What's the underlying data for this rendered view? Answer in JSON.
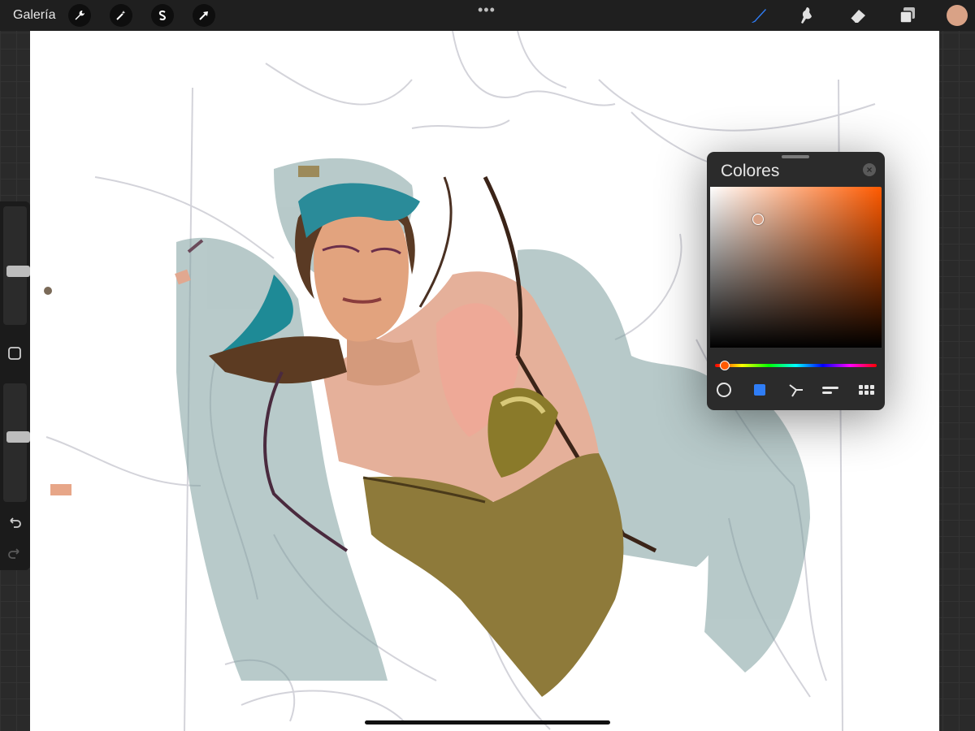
{
  "topbar": {
    "gallery_label": "Galería",
    "left_tools": [
      "wrench-icon",
      "magic-wand-icon",
      "selection-icon",
      "transform-icon"
    ],
    "more_label": "•••",
    "right_tools": [
      "brush-icon",
      "smudge-icon",
      "eraser-icon",
      "layers-icon"
    ],
    "active_tool": "brush-icon",
    "accent_color": "#2f7df6",
    "current_color": "#d9a286"
  },
  "sidebar": {
    "brush_size_level": 0.45,
    "opacity_level": 0.55,
    "undo_icon": "undo-icon",
    "redo_icon": "redo-icon",
    "modify_icon": "square-icon"
  },
  "color_panel": {
    "title": "Colores",
    "hue_color": "#ff5a00",
    "cursor_saturation": 0.28,
    "cursor_brightness": 0.8,
    "hue_position": 0.06,
    "modes": [
      "disc-icon",
      "classic-icon",
      "harmony-icon",
      "value-icon",
      "palettes-icon"
    ],
    "active_mode": "classic-icon"
  }
}
